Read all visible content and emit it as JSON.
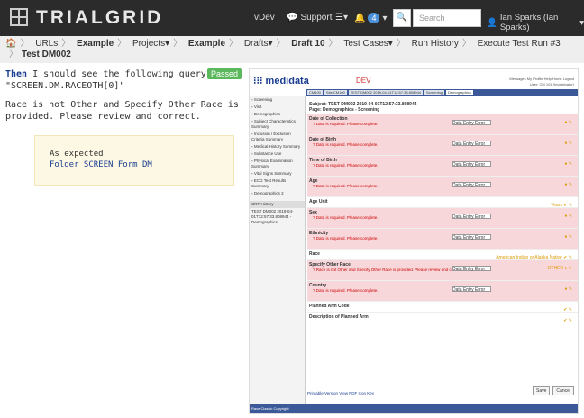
{
  "topbar": {
    "logo": "TRIALGRID",
    "env": "vDev",
    "support": "Support",
    "notifications": "4",
    "search_placeholder": "Search",
    "user": "Ian Sparks (Ian Sparks)"
  },
  "breadcrumb": {
    "items": [
      "URLs",
      "Example",
      "Projects",
      "Example",
      "Drafts",
      "Draft 10",
      "Test Cases",
      "Run History",
      "Execute Test Run #3"
    ],
    "current": "Test DM002"
  },
  "step": {
    "keyword": "Then",
    "text": " I should see the following query on \"SCREEN.DM.RACEOTH[0]\"",
    "status": "Passed"
  },
  "query_text": "Race is not Other and Specify Other Race is provided. Please review and correct.",
  "result": {
    "line1": "As expected",
    "line2": "Folder SCREEN Form DM"
  },
  "medidata": {
    "logo": "medidata",
    "env": "DEV",
    "links": "Messages  My Profile  Help  Home  Logout",
    "user": "User: CM 101 (Investigator)",
    "tabs": [
      "CM100",
      "Site CM100",
      "TEST DM002 2019-04-01T12:57:33.808944",
      "Screening",
      "Demographics"
    ],
    "sidebar": [
      "Screening",
      "Visit",
      "Demographics",
      "Subject Characteristics Summary",
      "Inclusion / Exclusion Criteria Summary",
      "Medical History Summary",
      "Substance Use",
      "Physical Examination Summary",
      "Vital Signs Summary",
      "ECG Test Results Summary",
      "Demographics 2"
    ],
    "crf_history": "CRF History",
    "crf_entry": "TEST DM002 2019-04-01T12:57:33.808944 - Demographics",
    "subject": "Subject: TEST DM002 2019-04-01T12:57:33.808944",
    "page": "Page: Demographics - Screening",
    "rows": [
      {
        "label": "Date of Collection",
        "error": "Data is required. Please complete."
      },
      {
        "label": "Date of Birth",
        "error": "Data is required. Please complete."
      },
      {
        "label": "Time of Birth",
        "error": "Data is required. Please complete."
      },
      {
        "label": "Age",
        "error": "Data is required. Please complete."
      },
      {
        "label": "Age Unit",
        "value": "Years"
      },
      {
        "label": "Sex",
        "error": "Data is required. Please complete."
      },
      {
        "label": "Ethnicity",
        "error": "Data is required. Please complete."
      },
      {
        "label": "Race",
        "value": "American Indian or Alaska Native"
      },
      {
        "label": "Specify Other Race",
        "error": "Race is not Other and Specify Other Race is provided. Please review and correct.",
        "value": "OTHER"
      },
      {
        "label": "Country",
        "error": "Data is required. Please complete."
      },
      {
        "label": "Planned Arm Code"
      },
      {
        "label": "Description of Planned Arm"
      }
    ],
    "dd_label": "Data Entry Error",
    "footlinks": "Printable Version  View PDF  Icon Key",
    "save": "Save",
    "cancel": "Cancel",
    "footer": "Rave Classic  Copyright"
  }
}
